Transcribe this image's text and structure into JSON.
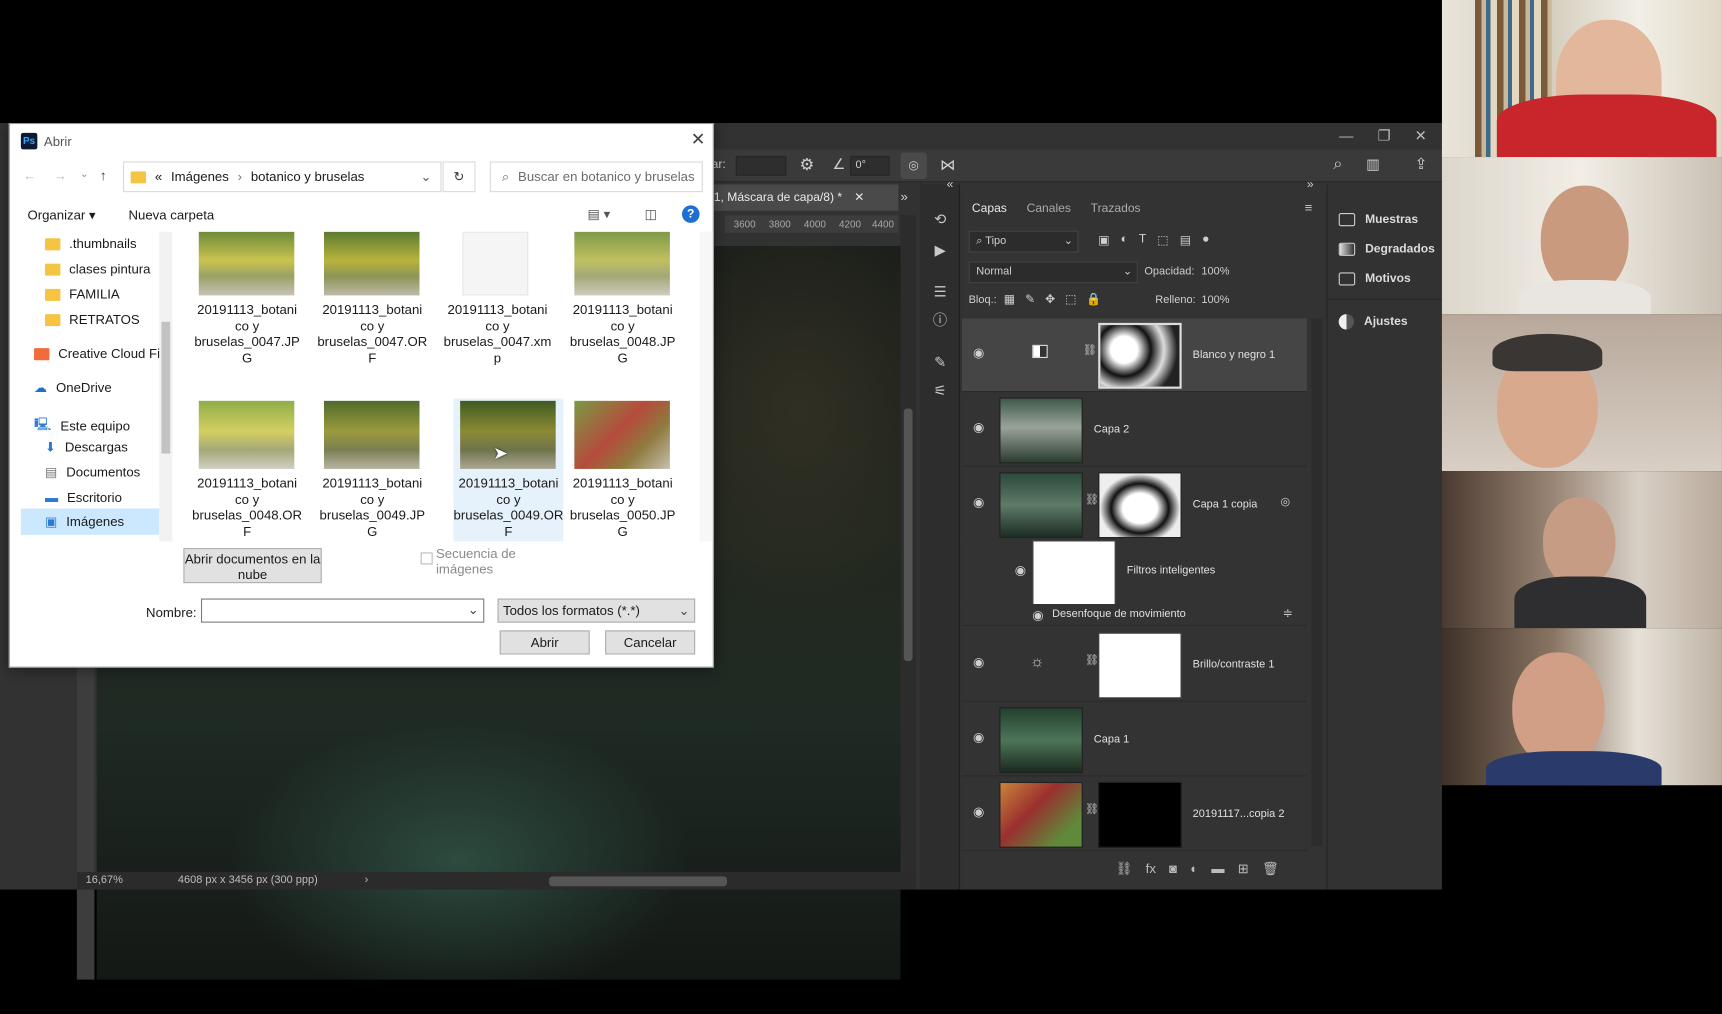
{
  "photoshop": {
    "doc_tab": "1, Máscara de capa/8) *",
    "ruler_ticks": [
      "3600",
      "3800",
      "4000",
      "4200",
      "4400"
    ],
    "angle": "0°",
    "zoom": "16,67%",
    "doc_size": "4608 px x 3456 px (300 ppp)",
    "option_label": "ar:",
    "layers_panel": {
      "tabs": [
        "Capas",
        "Canales",
        "Trazados"
      ],
      "filter": "Tipo",
      "blend_mode": "Normal",
      "opacity_label": "Opacidad:",
      "opacity": "100%",
      "lock_label": "Bloq.:",
      "fill_label": "Relleno:",
      "fill": "100%",
      "layers": [
        "Blanco y negro 1",
        "Capa 2",
        "Capa 1 copia",
        "Filtros inteligentes",
        "Desenfoque de movimiento",
        "Brillo/contraste 1",
        "Capa 1",
        "20191117...copia 2"
      ]
    },
    "adjust_panel": [
      "Muestras",
      "Degradados",
      "Motivos",
      "Ajustes"
    ]
  },
  "dialog": {
    "title": "Abrir",
    "breadcrumb_root": "«",
    "breadcrumb": [
      "Imágenes",
      "botanico y bruselas"
    ],
    "search_placeholder": "Buscar en botanico y bruselas",
    "organize": "Organizar",
    "new_folder": "Nueva carpeta",
    "nav": [
      ".thumbnails",
      "clases pintura",
      "FAMILIA",
      "RETRATOS",
      "Creative Cloud Fil",
      "OneDrive",
      "Este equipo",
      "Descargas",
      "Documentos",
      "Escritorio",
      "Imágenes"
    ],
    "files_row1": [
      [
        "20191113_botani",
        "co y",
        "bruselas_0047.JP",
        "G"
      ],
      [
        "20191113_botani",
        "co y",
        "bruselas_0047.OR",
        "F"
      ],
      [
        "20191113_botani",
        "co y",
        "bruselas_0047.xm",
        "p"
      ],
      [
        "20191113_botani",
        "co y",
        "bruselas_0048.JP",
        "G"
      ]
    ],
    "files_row2": [
      [
        "20191113_botani",
        "co y",
        "bruselas_0048.OR",
        "F"
      ],
      [
        "20191113_botani",
        "co y",
        "bruselas_0049.JP",
        "G"
      ],
      [
        "20191113_botani",
        "co y",
        "bruselas_0049.OR",
        "F"
      ],
      [
        "20191113_botani",
        "co y",
        "bruselas_0050.JP",
        "G"
      ]
    ],
    "cloud_button": "Abrir documentos en la nube",
    "sequence": "Secuencia de imágenes",
    "name_label": "Nombre:",
    "name_value": "",
    "format": "Todos los formatos (*.*)",
    "open_button": "Abrir",
    "cancel_button": "Cancelar"
  }
}
